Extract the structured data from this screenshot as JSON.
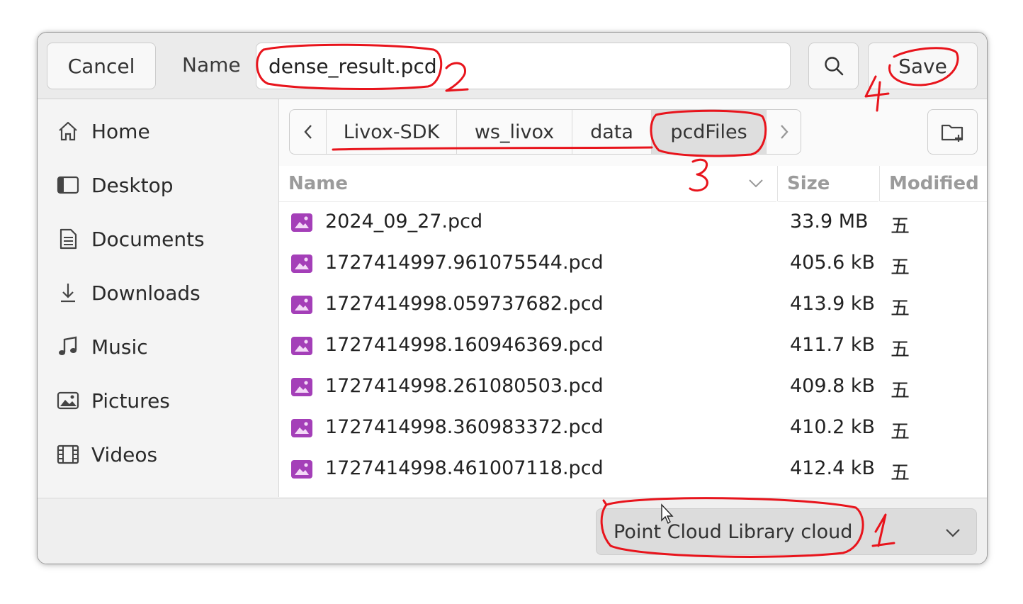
{
  "header": {
    "cancel_label": "Cancel",
    "name_label": "Name",
    "filename_value": "dense_result.pcd",
    "search_icon": "search-icon",
    "save_label": "Save"
  },
  "sidebar": {
    "items": [
      {
        "label": "Home",
        "icon": "home-icon"
      },
      {
        "label": "Desktop",
        "icon": "desktop-icon"
      },
      {
        "label": "Documents",
        "icon": "document-icon"
      },
      {
        "label": "Downloads",
        "icon": "download-icon"
      },
      {
        "label": "Music",
        "icon": "music-icon"
      },
      {
        "label": "Pictures",
        "icon": "picture-icon"
      },
      {
        "label": "Videos",
        "icon": "video-icon"
      }
    ]
  },
  "pathbar": {
    "segments": [
      "Livox-SDK",
      "ws_livox",
      "data",
      "pcdFiles"
    ],
    "active_segment": "pcdFiles"
  },
  "filelist": {
    "columns": {
      "name": "Name",
      "size": "Size",
      "modified": "Modified"
    },
    "rows": [
      {
        "name": "2024_09_27.pcd",
        "size": "33.9 MB",
        "modified": "五"
      },
      {
        "name": "1727414997.961075544.pcd",
        "size": "405.6 kB",
        "modified": "五"
      },
      {
        "name": "1727414998.059737682.pcd",
        "size": "413.9 kB",
        "modified": "五"
      },
      {
        "name": "1727414998.160946369.pcd",
        "size": "411.7 kB",
        "modified": "五"
      },
      {
        "name": "1727414998.261080503.pcd",
        "size": "409.8 kB",
        "modified": "五"
      },
      {
        "name": "1727414998.360983372.pcd",
        "size": "410.2 kB",
        "modified": "五"
      },
      {
        "name": "1727414998.461007118.pcd",
        "size": "412.4 kB",
        "modified": "五"
      }
    ]
  },
  "filter": {
    "selected": "Point Cloud Library cloud"
  },
  "annotations": {
    "marks": [
      "1",
      "2",
      "3",
      "4"
    ],
    "color": "#e8141c"
  },
  "colors": {
    "file_icon": "#a43fb8",
    "annotation": "#e8141c"
  }
}
